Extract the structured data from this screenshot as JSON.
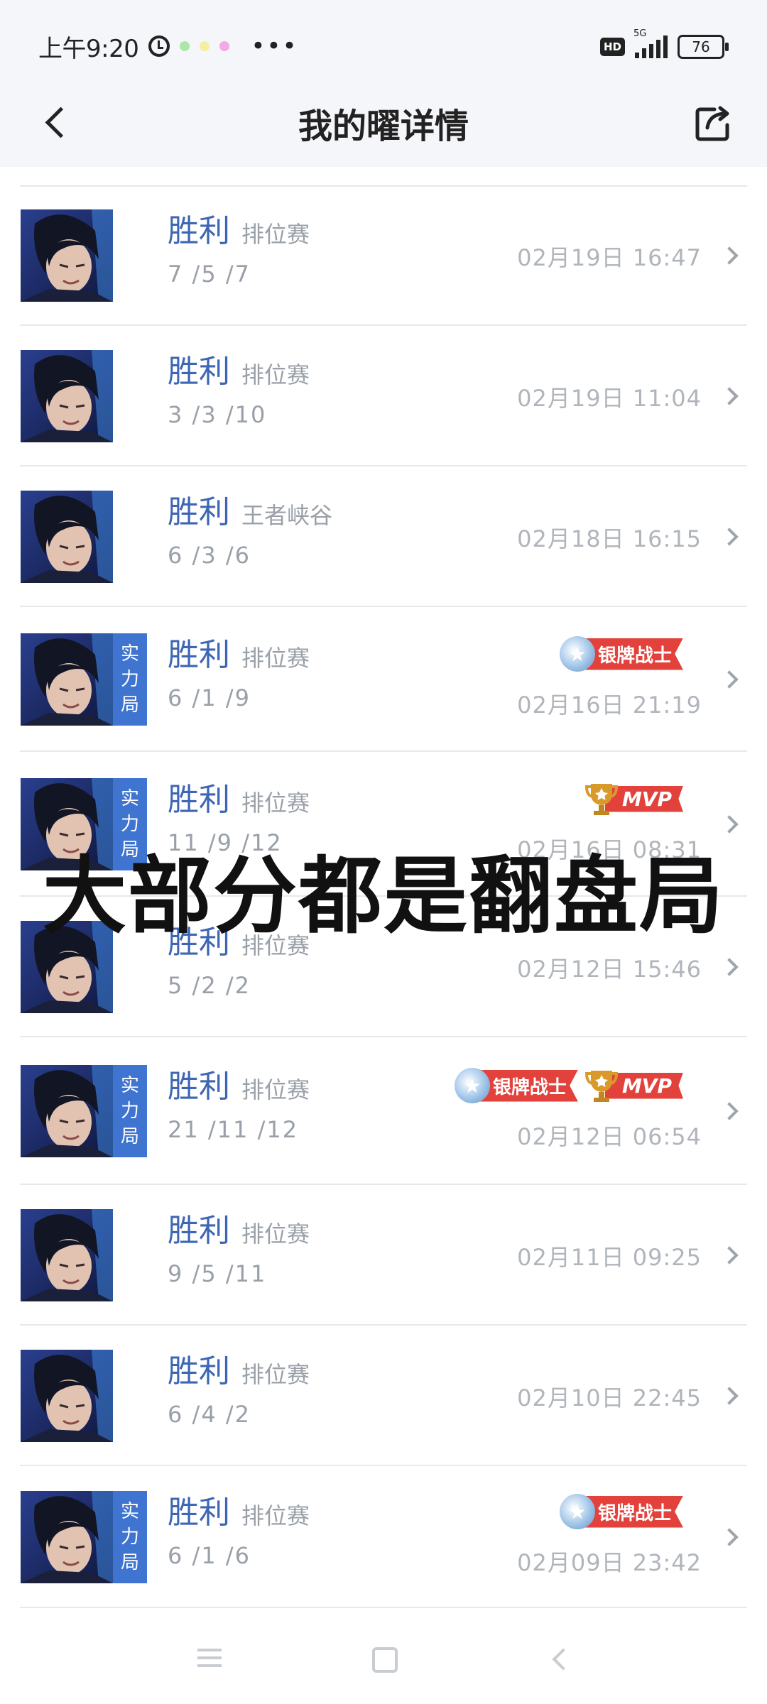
{
  "status_bar": {
    "time": "上午9:20",
    "network_label": "5G",
    "hd_label": "HD",
    "battery": "76"
  },
  "header": {
    "title": "我的曜详情"
  },
  "matches": [
    {
      "result": "胜利",
      "mode": "排位赛",
      "kda": "7 /5 /7",
      "time": "02月19日 16:47",
      "tag": "",
      "badges": []
    },
    {
      "result": "胜利",
      "mode": "排位赛",
      "kda": "3 /3 /10",
      "time": "02月19日 11:04",
      "tag": "",
      "badges": []
    },
    {
      "result": "胜利",
      "mode": "王者峡谷",
      "kda": "6 /3 /6",
      "time": "02月18日 16:15",
      "tag": "",
      "badges": []
    },
    {
      "result": "胜利",
      "mode": "排位赛",
      "kda": "6 /1 /9",
      "time": "02月16日 21:19",
      "tag": "实力局",
      "badges": [
        "银牌战士"
      ]
    },
    {
      "result": "胜利",
      "mode": "排位赛",
      "kda": "11 /9 /12",
      "time": "02月16日 08:31",
      "tag": "实力局",
      "badges": [
        "MVP"
      ]
    },
    {
      "result": "胜利",
      "mode": "排位赛",
      "kda": "5 /2 /2",
      "time": "02月12日 15:46",
      "tag": "",
      "badges": []
    },
    {
      "result": "胜利",
      "mode": "排位赛",
      "kda": "21 /11 /12",
      "time": "02月12日 06:54",
      "tag": "实力局",
      "badges": [
        "银牌战士",
        "MVP"
      ]
    },
    {
      "result": "胜利",
      "mode": "排位赛",
      "kda": "9 /5 /11",
      "time": "02月11日 09:25",
      "tag": "",
      "badges": []
    },
    {
      "result": "胜利",
      "mode": "排位赛",
      "kda": "6 /4 /2",
      "time": "02月10日 22:45",
      "tag": "",
      "badges": []
    },
    {
      "result": "胜利",
      "mode": "排位赛",
      "kda": "6 /1 /6",
      "time": "02月09日 23:42",
      "tag": "实力局",
      "badges": [
        "银牌战士"
      ]
    }
  ],
  "overlay_caption": "大部分都是翻盘局",
  "colors": {
    "result_blue": "#3d66b4",
    "tag_blue": "#3f74d0",
    "badge_red": "#e2423b",
    "header_bg": "#f5f6f9"
  },
  "icons": {
    "back": "back-arrow-icon",
    "share": "share-icon",
    "alarm": "alarm-icon",
    "chevron": "chevron-right-icon",
    "medal": "silver-medal-icon",
    "trophy": "trophy-icon"
  }
}
